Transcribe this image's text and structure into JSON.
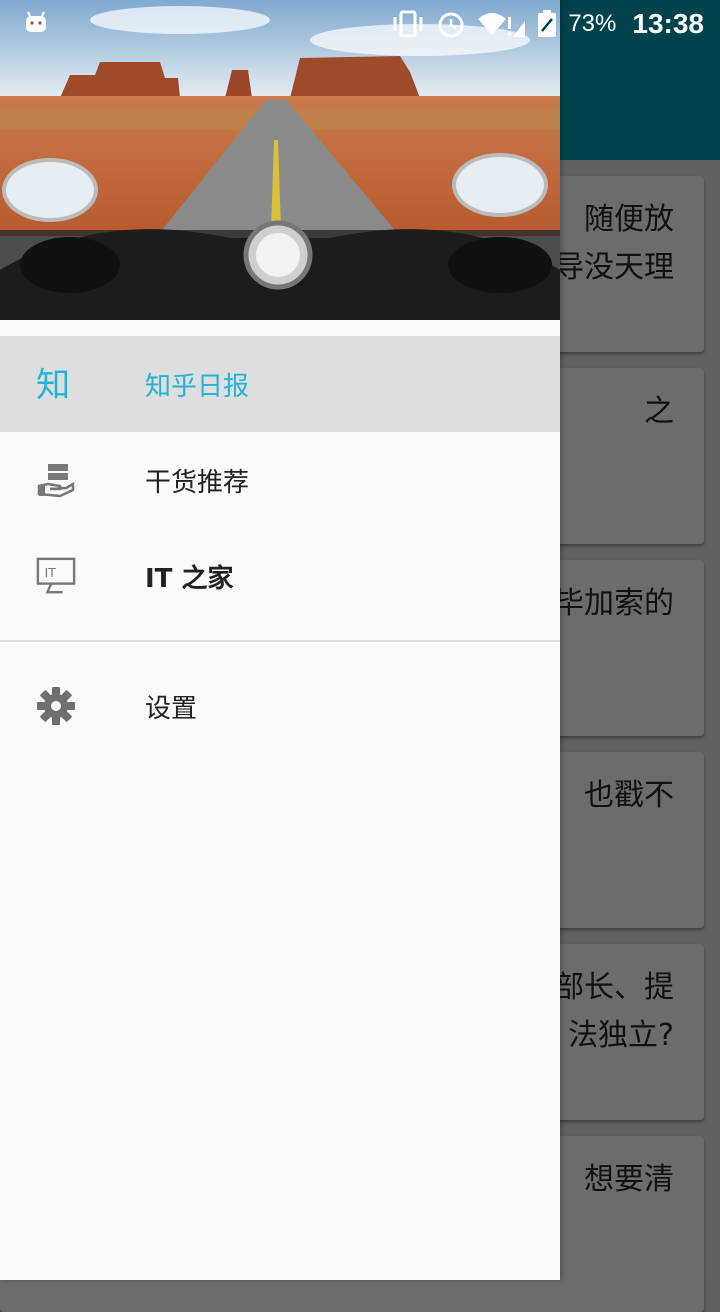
{
  "status_bar": {
    "battery_percent": "73%",
    "time": "13:38"
  },
  "drawer": {
    "menu": [
      {
        "label": "知乎日报",
        "icon": "zhihu-icon",
        "active": true
      },
      {
        "label": "干货推荐",
        "icon": "server-hand-icon",
        "active": false
      },
      {
        "label": "IT 之家",
        "icon": "it-monitor-icon",
        "active": false
      }
    ],
    "settings": {
      "label": "设置",
      "icon": "gear-icon"
    }
  },
  "background_list": {
    "cards": [
      {
        "line1": "随便放",
        "line2": "导没天理"
      },
      {
        "line1": "之",
        "line2": ""
      },
      {
        "line1": "毕加索的",
        "line2": ""
      },
      {
        "line1": "也戳不",
        "line2": ""
      },
      {
        "line1": "部长、提",
        "line2": "法独立?"
      },
      {
        "line1": "想要清",
        "line2": ""
      }
    ]
  },
  "colors": {
    "accent": "#23b3d6",
    "toolbar": "#00434c"
  }
}
